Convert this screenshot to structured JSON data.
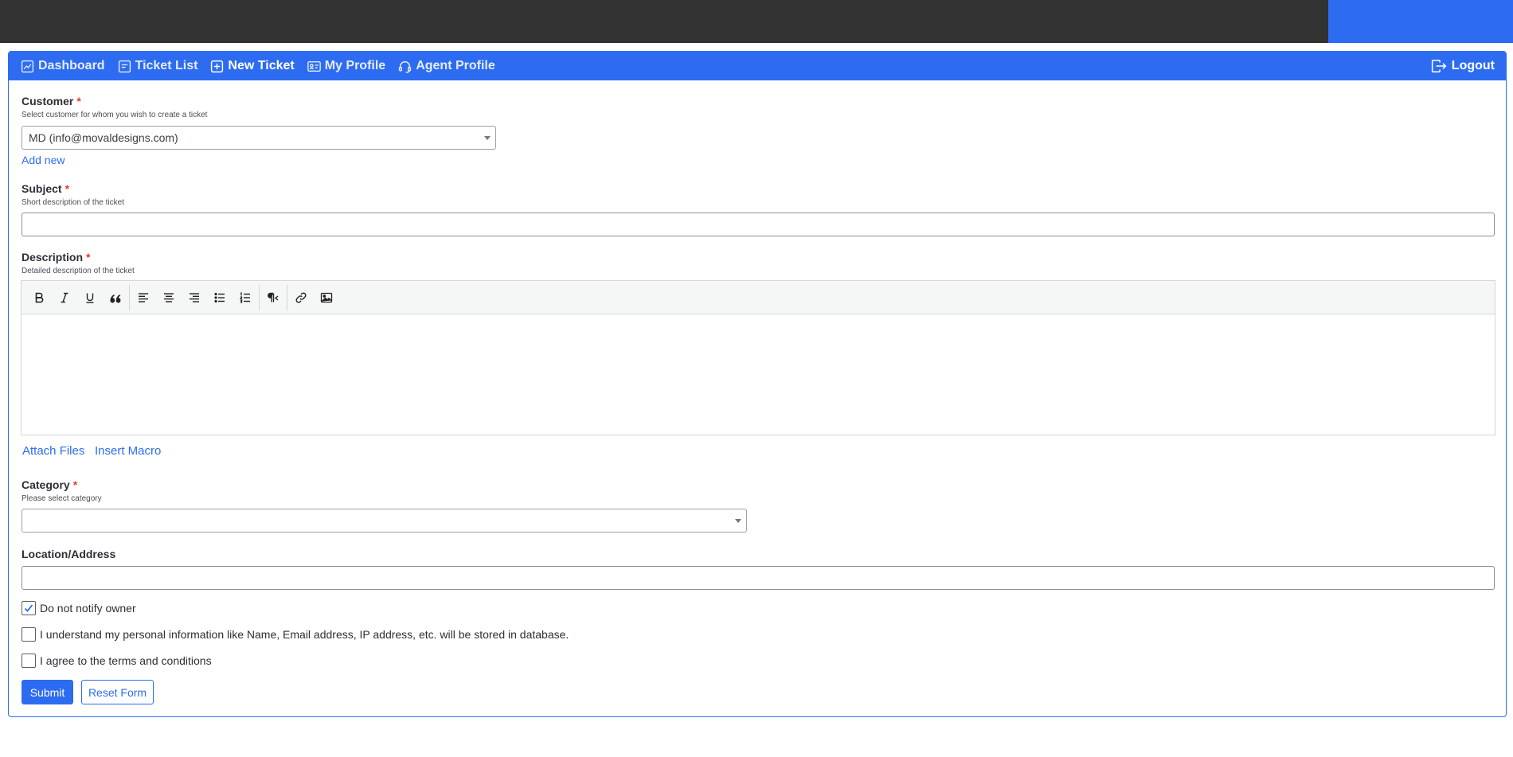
{
  "colors": {
    "accent": "#2d6cf0",
    "topbar": "#323232",
    "required": "#e53935"
  },
  "nav": {
    "items": [
      {
        "label": "Dashboard",
        "icon": "chart-icon"
      },
      {
        "label": "Ticket List",
        "icon": "list-icon"
      },
      {
        "label": "New Ticket",
        "icon": "plus-square-icon",
        "active": true
      },
      {
        "label": "My Profile",
        "icon": "id-card-icon"
      },
      {
        "label": "Agent Profile",
        "icon": "headset-icon"
      }
    ],
    "logout_label": "Logout"
  },
  "form": {
    "customer": {
      "label": "Customer",
      "required_mark": "*",
      "hint": "Select customer for whom you wish to create a ticket",
      "selected": "MD (info@movaldesigns.com)",
      "add_new": "Add new"
    },
    "subject": {
      "label": "Subject",
      "required_mark": "*",
      "hint": "Short description of the ticket",
      "value": ""
    },
    "description": {
      "label": "Description",
      "required_mark": "*",
      "hint": "Detailed description of the ticket",
      "toolbar": [
        "bold",
        "italic",
        "underline",
        "blockquote",
        "align-left",
        "align-center",
        "align-right",
        "bullet-list",
        "numbered-list",
        "paragraph-rtl",
        "link",
        "image"
      ]
    },
    "attach_files": "Attach Files",
    "insert_macro": "Insert Macro",
    "category": {
      "label": "Category",
      "required_mark": "*",
      "hint": "Please select category",
      "selected": ""
    },
    "location": {
      "label": "Location/Address",
      "value": ""
    },
    "checks": {
      "notify": {
        "label": "Do not notify owner",
        "checked": true
      },
      "privacy": {
        "label": "I understand my personal information like Name, Email address, IP address, etc. will be stored in database.",
        "checked": false
      },
      "terms": {
        "label": "I agree to the terms and conditions",
        "checked": false
      }
    },
    "submit_label": "Submit",
    "reset_label": "Reset Form"
  }
}
